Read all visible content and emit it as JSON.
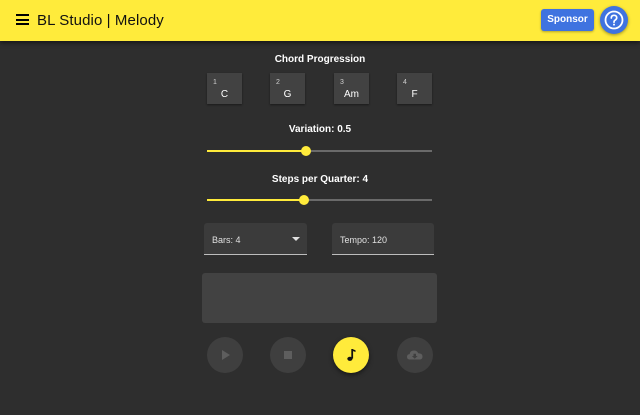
{
  "appbar": {
    "title": "BL Studio | Melody",
    "sponsor_label": "Sponsor",
    "background": "#ffeb3b",
    "button_color": "#3f73e0"
  },
  "chord_progression": {
    "label": "Chord Progression",
    "chords": [
      {
        "num": "1",
        "name": "C"
      },
      {
        "num": "2",
        "name": "G"
      },
      {
        "num": "3",
        "name": "Am"
      },
      {
        "num": "4",
        "name": "F"
      }
    ]
  },
  "variation": {
    "label": "Variation: 0.5",
    "value": 0.5,
    "fraction": 0.44
  },
  "steps": {
    "label": "Steps per Quarter: 4",
    "value": 4,
    "fraction": 0.43
  },
  "bars": {
    "label": "Bars: 4"
  },
  "tempo": {
    "label": "Tempo: 120"
  },
  "controls": {
    "play": "play-icon",
    "stop": "stop-icon",
    "generate": "music-note-icon",
    "download": "cloud-download-icon"
  },
  "accent": "#ffeb3b"
}
